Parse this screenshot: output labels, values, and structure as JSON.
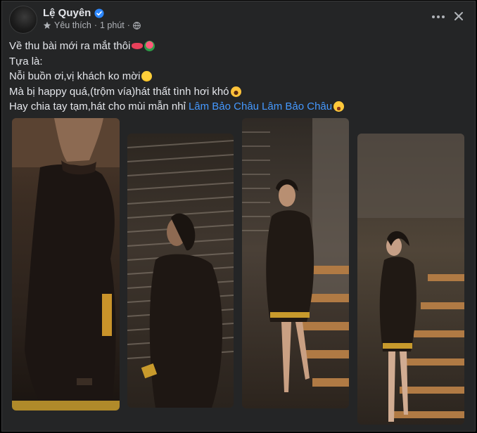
{
  "post": {
    "author": "Lệ Quyên",
    "audience_label": "Yêu thích",
    "separator": "·",
    "time": "1 phút",
    "lines": [
      "Về thu bài mới ra mắt thôi",
      "Tựa là:",
      "Nỗi buồn ơi,vị khách ko mời",
      "Mà bị happy quá,(trộm vía)hát thất tình hơi khó",
      "Hay chia tay tạm,hát cho mùi mẫn nhỉ"
    ],
    "mentions": [
      "Lâm Bảo Châu",
      "Lâm Bảo Châu"
    ],
    "photos": [
      {
        "alt": "Người phụ nữ mặc váy len đen bó sát, cận cảnh nghiêng"
      },
      {
        "alt": "Người phụ nữ tóc buộc, đứng trước kệ rượu"
      },
      {
        "alt": "Người phụ nữ đứng trên cầu thang gỗ, giày cao gót"
      },
      {
        "alt": "Người phụ nữ đứng trên cầu thang gỗ nhìn sang phải"
      }
    ]
  },
  "icons": {
    "verified": "verified-badge-icon",
    "star": "star-icon",
    "globe": "globe-icon",
    "more": "more-icon",
    "close": "close-icon"
  },
  "colors": {
    "background": "#242526",
    "text": "#e4e6eb",
    "muted": "#b0b3b8",
    "mention": "#4599ff",
    "verified": "#2d88ff"
  }
}
